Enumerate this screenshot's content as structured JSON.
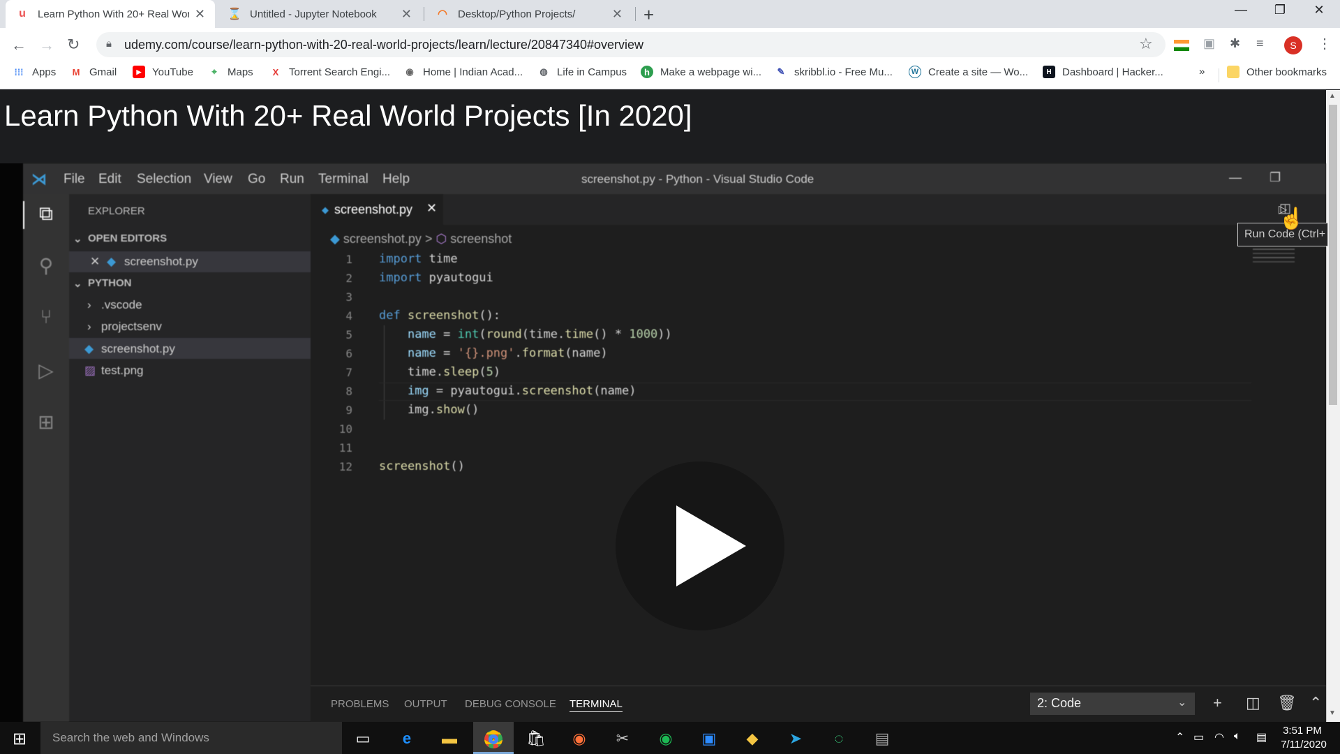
{
  "browser": {
    "tabs": [
      {
        "title": "Learn Python With 20+ Real Wor",
        "active": true,
        "icon": "udemy-icon"
      },
      {
        "title": "Untitled - Jupyter Notebook",
        "active": false,
        "icon": "hourglass-icon"
      },
      {
        "title": "Desktop/Python Projects/",
        "active": false,
        "icon": "loading-icon"
      }
    ],
    "url": "udemy.com/course/learn-python-with-20-real-world-projects/learn/lecture/20847340#overview",
    "profile_initial": "S",
    "bookmarks": [
      {
        "label": "Apps",
        "icon": "apps-grid-icon"
      },
      {
        "label": "Gmail",
        "icon": "gmail-icon"
      },
      {
        "label": "YouTube",
        "icon": "youtube-icon"
      },
      {
        "label": "Maps",
        "icon": "maps-icon"
      },
      {
        "label": "Torrent Search Engi...",
        "icon": "torrent-icon"
      },
      {
        "label": "Home | Indian Acad...",
        "icon": "academy-icon"
      },
      {
        "label": "Life in Campus",
        "icon": "globe-icon"
      },
      {
        "label": "Make a webpage wi...",
        "icon": "webpage-icon"
      },
      {
        "label": "skribbl.io - Free Mu...",
        "icon": "skribbl-icon"
      },
      {
        "label": "Create a site — Wo...",
        "icon": "wordpress-icon"
      },
      {
        "label": "Dashboard | Hacker...",
        "icon": "hackerrank-icon"
      }
    ],
    "bookmarks_overflow": "»",
    "other_bookmarks": "Other bookmarks"
  },
  "course": {
    "title": "Learn Python With 20+ Real World Projects [In 2020]"
  },
  "vscode": {
    "menu": [
      "File",
      "Edit",
      "Selection",
      "View",
      "Go",
      "Run",
      "Terminal",
      "Help"
    ],
    "window_title": "screenshot.py - Python - Visual Studio Code",
    "explorer_label": "EXPLORER",
    "open_editors_label": "OPEN EDITORS",
    "open_editor_file": "screenshot.py",
    "folder_label": "PYTHON",
    "tree": [
      ".vscode",
      "projectsenv",
      "screenshot.py",
      "test.png"
    ],
    "editor_tab": "screenshot.py",
    "breadcrumb_file": "screenshot.py",
    "breadcrumb_sep": ">",
    "breadcrumb_symbol": "screenshot",
    "line_numbers": [
      "1",
      "2",
      "3",
      "4",
      "5",
      "6",
      "7",
      "8",
      "9",
      "10",
      "11",
      "12"
    ],
    "tooltip": "Run Code (Ctrl+",
    "panel_tabs": [
      "PROBLEMS",
      "OUTPUT",
      "DEBUG CONSOLE",
      "TERMINAL"
    ],
    "terminal_select": "2: Code"
  },
  "taskbar": {
    "search_placeholder": "Search the web and Windows",
    "time": "3:51 PM",
    "date": "7/11/2020"
  },
  "colors": {
    "udemy_red": "#ec5252",
    "vscode_blue": "#007acc",
    "chrome_tab_bg": "#dee1e6"
  }
}
